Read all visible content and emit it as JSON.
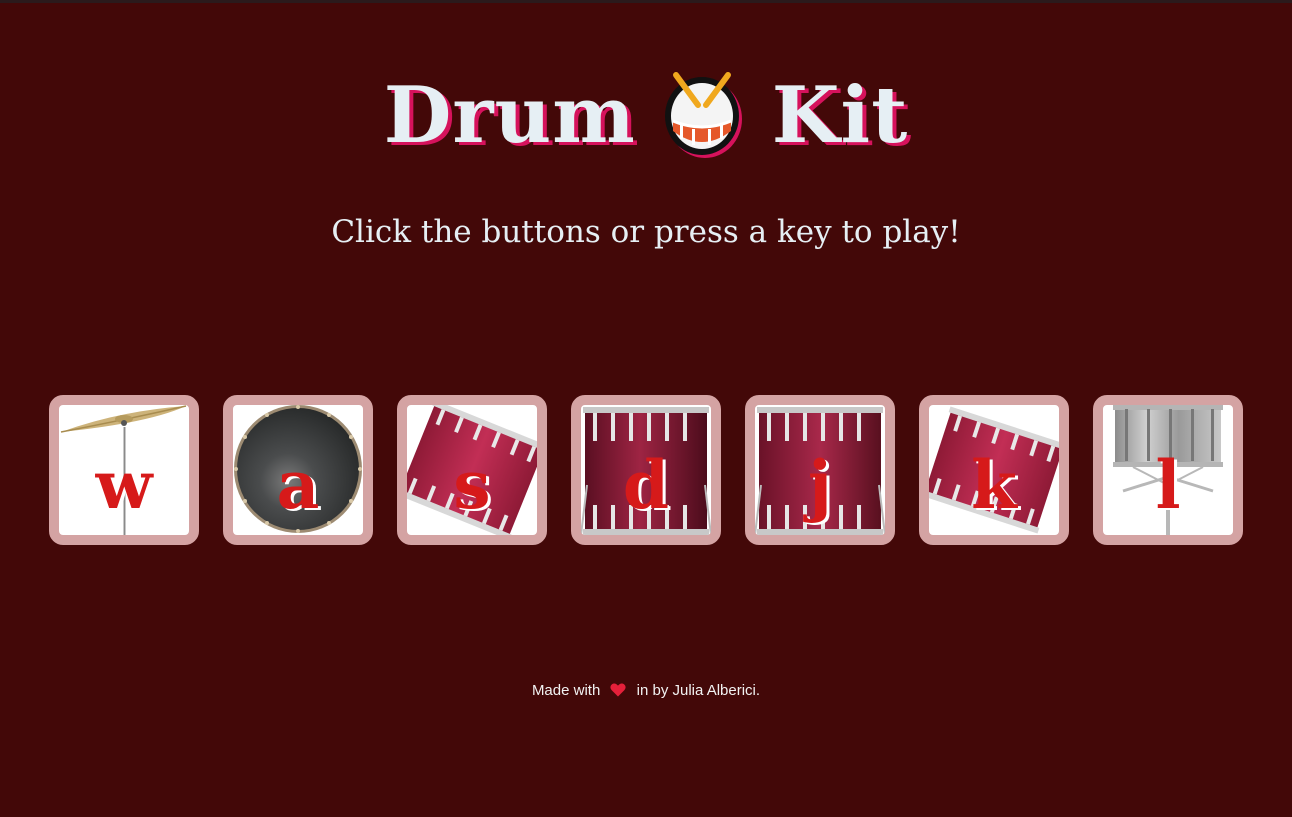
{
  "header": {
    "title_left": "Drum",
    "title_right": "Kit",
    "title_icon": "drum-icon",
    "subtitle": "Click the buttons or press a key to play!"
  },
  "drums": [
    {
      "key": "w",
      "instrument": "crash-cymbal-icon"
    },
    {
      "key": "a",
      "instrument": "bass-drum-icon"
    },
    {
      "key": "s",
      "instrument": "tilted-tom-icon"
    },
    {
      "key": "d",
      "instrument": "floor-tom-icon"
    },
    {
      "key": "j",
      "instrument": "floor-tom-icon"
    },
    {
      "key": "k",
      "instrument": "tilted-tom-icon"
    },
    {
      "key": "l",
      "instrument": "snare-drum-icon"
    }
  ],
  "footer": {
    "made_with": "Made with",
    "heart_icon": "heart-icon",
    "credit": "in by Julia Alberici."
  },
  "colors": {
    "background": "#430808",
    "title_text": "#e6eff4",
    "title_shadow": "#d6125c",
    "key_letter": "#d61a1a",
    "button_border": "#d4a3a3"
  }
}
